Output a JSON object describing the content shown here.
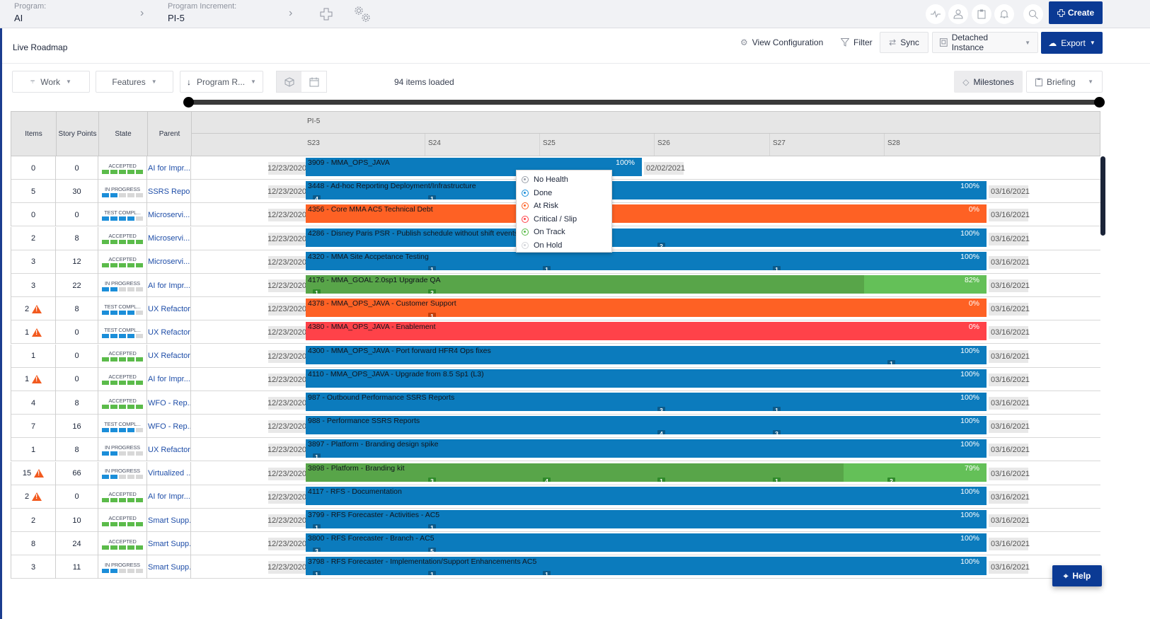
{
  "header": {
    "program_label": "Program:",
    "program_value": "AI",
    "increment_label": "Program Increment:",
    "increment_value": "PI-5",
    "icons": [
      "add-icon",
      "settings-gears-icon"
    ],
    "right_icons": [
      "activity-icon",
      "user-icon",
      "clipboard-icon",
      "bell-icon",
      "search-icon"
    ],
    "create_label": "Create"
  },
  "subheader": {
    "page_title": "Live Roadmap",
    "view_config_label": "View Configuration",
    "filter_label": "Filter",
    "sync_label": "Sync",
    "detached_label": "Detached Instance",
    "export_label": "Export"
  },
  "controls": {
    "work_label": "Work",
    "features_label": "Features",
    "program_label": "Program R...",
    "items_loaded": "94 items loaded",
    "milestones_label": "Milestones",
    "briefing_label": "Briefing"
  },
  "grid": {
    "columns": [
      "Items",
      "Story Points",
      "State",
      "Parent"
    ],
    "pi_label": "PI-5",
    "sprints": [
      "S23",
      "S24",
      "S25",
      "S26",
      "S27",
      "S28"
    ]
  },
  "colors": {
    "blue": "#0b7bbd",
    "orange": "#fe6124",
    "red": "#ff4249",
    "green_done": "#58a549",
    "green_todo": "#64c058",
    "accepted": "#5bbb4a",
    "in_progress": "#1b8ed9",
    "badge_blue": "#0c5a8a",
    "badge_orange": "#c23e0a",
    "badge_green": "#2f8a2a",
    "primary": "#0b3a94"
  },
  "health_menu": [
    {
      "label": "No Health",
      "color": "#9aa0aa"
    },
    {
      "label": "Done",
      "color": "#1b8ed9"
    },
    {
      "label": "At Risk",
      "color": "#fe6124"
    },
    {
      "label": "Critical / Slip",
      "color": "#ff4249"
    },
    {
      "label": "On Track",
      "color": "#5bbb4a"
    },
    {
      "label": "On Hold",
      "color": "#d4d6da"
    }
  ],
  "rows": [
    {
      "items": "0",
      "warn": false,
      "sp": "0",
      "state": "ACCEPTED",
      "state_fill": 5,
      "state_color": "accepted",
      "parent": "AI for Impr...",
      "start": "12/23/2020",
      "title": "3909 - MMA_OPS_JAVA",
      "health": "blue",
      "progress": 100,
      "pct": "100%",
      "end": "02/02/2021",
      "span": "short",
      "milestones": []
    },
    {
      "items": "5",
      "warn": false,
      "sp": "30",
      "state": "IN PROGRESS",
      "state_fill": 2,
      "state_color": "in_progress",
      "parent": "SSRS Repo...",
      "start": "12/23/2020",
      "title": "3448 - Ad-hoc Reporting Deployment/Infrastructure",
      "health": "blue",
      "progress": 100,
      "pct": "100%",
      "end": "03/16/2021",
      "span": "full",
      "milestones": [
        {
          "sprint": 0,
          "count": "4"
        },
        {
          "sprint": 1,
          "count": "1"
        }
      ]
    },
    {
      "items": "0",
      "warn": false,
      "sp": "0",
      "state": "TEST COMPL...",
      "state_fill": 4,
      "state_color": "in_progress",
      "parent": "Microservi...",
      "start": "12/23/2020",
      "title": "4356 - Core MMA AC5 Technical Debt",
      "health": "orange",
      "progress": 0,
      "pct": "0%",
      "end": "03/16/2021",
      "span": "full",
      "milestones": []
    },
    {
      "items": "2",
      "warn": false,
      "sp": "8",
      "state": "ACCEPTED",
      "state_fill": 5,
      "state_color": "accepted",
      "parent": "Microservi...",
      "start": "12/23/2020",
      "title": "4286 - Disney Paris PSR - Publish schedule without shift events o",
      "health": "blue",
      "progress": 100,
      "pct": "100%",
      "end": "03/16/2021",
      "span": "full",
      "milestones": [
        {
          "sprint": 3,
          "count": "2"
        }
      ]
    },
    {
      "items": "3",
      "warn": false,
      "sp": "12",
      "state": "ACCEPTED",
      "state_fill": 5,
      "state_color": "accepted",
      "parent": "Microservi...",
      "start": "12/23/2020",
      "title": "4320 - MMA Site Accpetance Testing",
      "health": "blue",
      "progress": 100,
      "pct": "100%",
      "end": "03/16/2021",
      "span": "full",
      "milestones": [
        {
          "sprint": 1,
          "count": "1"
        },
        {
          "sprint": 2,
          "count": "1"
        },
        {
          "sprint": 4,
          "count": "1"
        }
      ]
    },
    {
      "items": "3",
      "warn": false,
      "sp": "22",
      "state": "IN PROGRESS",
      "state_fill": 2,
      "state_color": "in_progress",
      "parent": "AI for Impr...",
      "start": "12/23/2020",
      "title": "4176 - MMA_GOAL 2.0sp1 Upgrade QA",
      "health": "green",
      "progress": 82,
      "pct": "82%",
      "end": "03/16/2021",
      "span": "full",
      "milestones": [
        {
          "sprint": 0,
          "count": "1"
        },
        {
          "sprint": 1,
          "count": "2"
        }
      ]
    },
    {
      "items": "2",
      "warn": true,
      "sp": "8",
      "state": "TEST COMPL...",
      "state_fill": 4,
      "state_color": "in_progress",
      "parent": "UX Refactor",
      "start": "12/23/2020",
      "title": "4378 - MMA_OPS_JAVA - Customer Support",
      "health": "orange",
      "progress": 0,
      "pct": "0%",
      "end": "03/16/2021",
      "span": "full",
      "milestones": [
        {
          "sprint": 1,
          "count": "1"
        }
      ]
    },
    {
      "items": "1",
      "warn": true,
      "sp": "0",
      "state": "TEST COMPL...",
      "state_fill": 4,
      "state_color": "in_progress",
      "parent": "UX Refactor",
      "start": "12/23/2020",
      "title": "4380 - MMA_OPS_JAVA - Enablement",
      "health": "red",
      "progress": 0,
      "pct": "0%",
      "end": "03/16/2021",
      "span": "full",
      "milestones": []
    },
    {
      "items": "1",
      "warn": false,
      "sp": "0",
      "state": "ACCEPTED",
      "state_fill": 5,
      "state_color": "accepted",
      "parent": "UX Refactor",
      "start": "12/23/2020",
      "title": "4300 - MMA_OPS_JAVA - Port forward HFR4 Ops fixes",
      "health": "blue",
      "progress": 100,
      "pct": "100%",
      "end": "03/16/2021",
      "span": "full",
      "milestones": [
        {
          "sprint": 5,
          "count": "1"
        }
      ]
    },
    {
      "items": "1",
      "warn": true,
      "sp": "0",
      "state": "ACCEPTED",
      "state_fill": 5,
      "state_color": "accepted",
      "parent": "AI for Impr...",
      "start": "12/23/2020",
      "title": "4110 - MMA_OPS_JAVA - Upgrade from 8.5 Sp1 (L3)",
      "health": "blue",
      "progress": 100,
      "pct": "100%",
      "end": "03/16/2021",
      "span": "full",
      "milestones": []
    },
    {
      "items": "4",
      "warn": false,
      "sp": "8",
      "state": "ACCEPTED",
      "state_fill": 5,
      "state_color": "accepted",
      "parent": "WFO - Rep...",
      "start": "12/23/2020",
      "title": "987 - Outbound Performance SSRS Reports",
      "health": "blue",
      "progress": 100,
      "pct": "100%",
      "end": "03/16/2021",
      "span": "full",
      "milestones": [
        {
          "sprint": 3,
          "count": "3"
        },
        {
          "sprint": 4,
          "count": "1"
        }
      ]
    },
    {
      "items": "7",
      "warn": false,
      "sp": "16",
      "state": "TEST COMPL...",
      "state_fill": 4,
      "state_color": "in_progress",
      "parent": "WFO - Rep...",
      "start": "12/23/2020",
      "title": "988 - Performance SSRS Reports",
      "health": "blue",
      "progress": 100,
      "pct": "100%",
      "end": "03/16/2021",
      "span": "full",
      "milestones": [
        {
          "sprint": 3,
          "count": "4"
        },
        {
          "sprint": 4,
          "count": "3"
        }
      ]
    },
    {
      "items": "1",
      "warn": false,
      "sp": "8",
      "state": "IN PROGRESS",
      "state_fill": 2,
      "state_color": "in_progress",
      "parent": "UX Refactor",
      "start": "12/23/2020",
      "title": "3897 - Platform - Branding design spike",
      "health": "blue",
      "progress": 100,
      "pct": "100%",
      "end": "03/16/2021",
      "span": "full",
      "milestones": [
        {
          "sprint": 0,
          "count": "1"
        }
      ]
    },
    {
      "items": "15",
      "warn": true,
      "sp": "66",
      "state": "IN PROGRESS",
      "state_fill": 2,
      "state_color": "in_progress",
      "parent": "Virtualized ...",
      "start": "12/23/2020",
      "title": "3898 - Platform - Branding kit",
      "health": "green",
      "progress": 79,
      "pct": "79%",
      "end": "03/16/2021",
      "span": "full",
      "milestones": [
        {
          "sprint": 1,
          "count": "3"
        },
        {
          "sprint": 2,
          "count": "4"
        },
        {
          "sprint": 3,
          "count": "1"
        },
        {
          "sprint": 4,
          "count": "1"
        },
        {
          "sprint": 5,
          "count": "2"
        }
      ]
    },
    {
      "items": "2",
      "warn": true,
      "sp": "0",
      "state": "ACCEPTED",
      "state_fill": 5,
      "state_color": "accepted",
      "parent": "AI for Impr...",
      "start": "12/23/2020",
      "title": "4117 - RFS - Documentation",
      "health": "blue",
      "progress": 100,
      "pct": "100%",
      "end": "03/16/2021",
      "span": "full",
      "milestones": []
    },
    {
      "items": "2",
      "warn": false,
      "sp": "10",
      "state": "ACCEPTED",
      "state_fill": 5,
      "state_color": "accepted",
      "parent": "Smart Supp...",
      "start": "12/23/2020",
      "title": "3799 - RFS Forecaster - Activities - AC5",
      "health": "blue",
      "progress": 100,
      "pct": "100%",
      "end": "03/16/2021",
      "span": "full",
      "milestones": [
        {
          "sprint": 0,
          "count": "1"
        },
        {
          "sprint": 1,
          "count": "1"
        }
      ]
    },
    {
      "items": "8",
      "warn": false,
      "sp": "24",
      "state": "ACCEPTED",
      "state_fill": 5,
      "state_color": "accepted",
      "parent": "Smart Supp...",
      "start": "12/23/2020",
      "title": "3800 - RFS Forecaster - Branch - AC5",
      "health": "blue",
      "progress": 100,
      "pct": "100%",
      "end": "03/16/2021",
      "span": "full",
      "milestones": [
        {
          "sprint": 0,
          "count": "3"
        },
        {
          "sprint": 1,
          "count": "5"
        }
      ]
    },
    {
      "items": "3",
      "warn": false,
      "sp": "11",
      "state": "IN PROGRESS",
      "state_fill": 2,
      "state_color": "in_progress",
      "parent": "Smart Supp...",
      "start": "12/23/2020",
      "title": "3798 - RFS Forecaster - Implementation/Support Enhancements AC5",
      "health": "blue",
      "progress": 100,
      "pct": "100%",
      "end": "03/16/2021",
      "span": "full",
      "milestones": [
        {
          "sprint": 0,
          "count": "1"
        },
        {
          "sprint": 1,
          "count": "1"
        },
        {
          "sprint": 2,
          "count": "1"
        }
      ]
    }
  ],
  "help_label": "Help"
}
